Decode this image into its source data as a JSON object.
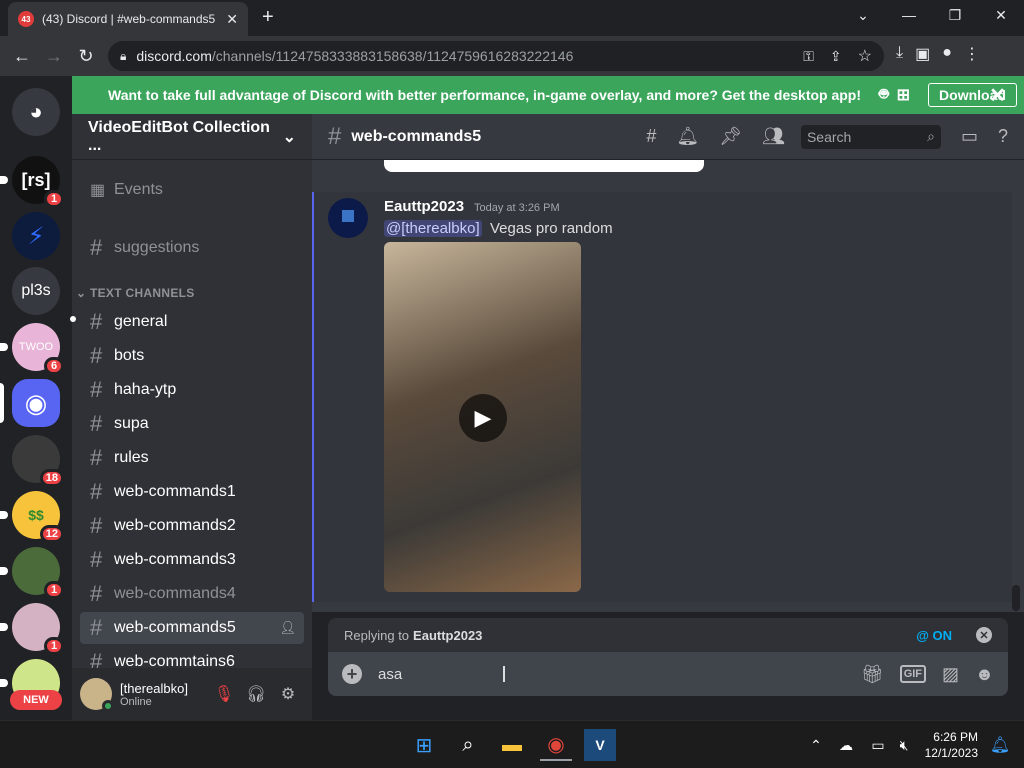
{
  "browser": {
    "tab_title": "(43) Discord | #web-commands5",
    "tab_badge": "43",
    "url_domain": "discord.com",
    "url_path": "/channels/1124758333883158638/1124759616283222146"
  },
  "banner": {
    "text": "Want to take full advantage of Discord with better performance, in-game overlay, and more? Get the desktop app!",
    "button": "Download"
  },
  "guilds": [
    {
      "label": "[rs]",
      "badge": "1",
      "color": "#111"
    },
    {
      "label": "",
      "badge": "",
      "color": "#0d1b3d"
    },
    {
      "label": "pl3s",
      "badge": "",
      "color": "#36393f"
    },
    {
      "label": "TWOO",
      "badge": "6",
      "color": "#e8b5d8"
    },
    {
      "label": "",
      "badge": "",
      "color": "#5865f2"
    },
    {
      "label": "",
      "badge": "18",
      "color": "#3a3a3a"
    },
    {
      "label": "$$",
      "badge": "12",
      "color": "#f6c33b"
    },
    {
      "label": "",
      "badge": "1",
      "color": "#4b6b3a"
    },
    {
      "label": "",
      "badge": "1",
      "color": "#d4b2c3"
    },
    {
      "label": "",
      "badge": "1",
      "color": "#cfe58a"
    }
  ],
  "new_label": "NEW",
  "sidebar": {
    "server_name": "VideoEditBot Collection ...",
    "events": "Events",
    "suggestions": "suggestions",
    "category": "TEXT CHANNELS",
    "channels": [
      "general",
      "bots",
      "haha-ytp",
      "supa",
      "rules",
      "web-commands1",
      "web-commands2",
      "web-commands3",
      "web-commands4",
      "web-commands5",
      "web-commtains6"
    ]
  },
  "user": {
    "name": "[therealbko]",
    "status": "Online"
  },
  "chat": {
    "channel": "web-commands5",
    "search_placeholder": "Search",
    "message": {
      "author": "Eauttp2023",
      "timestamp": "Today at 3:26 PM",
      "mention": "@[therealbko]",
      "text": "Vegas pro random"
    },
    "reply": {
      "prefix": "Replying to",
      "name": "Eauttp2023",
      "mention_toggle": "@ ON"
    },
    "input_value": "asa"
  },
  "taskbar": {
    "time": "6:26 PM",
    "date": "12/1/2023"
  }
}
